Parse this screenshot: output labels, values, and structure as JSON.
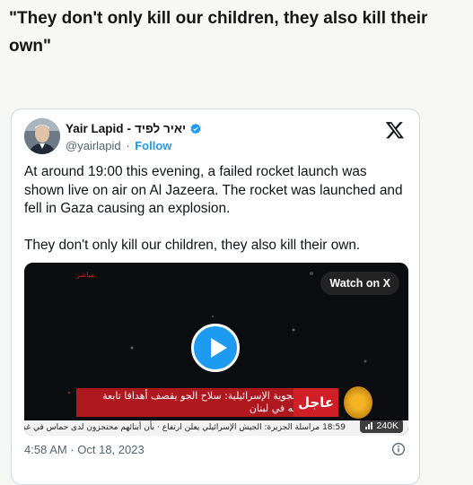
{
  "headline": "\"They don't only kill our children, they also kill their own\"",
  "tweet": {
    "author_name": "Yair Lapid",
    "author_name_hebrew": "יאיר לפיד",
    "name_separator": "-",
    "handle": "@yairlapid",
    "separator_dot": "·",
    "follow_label": "Follow",
    "text_paragraphs": [
      "At around 19:00 this evening, a failed rocket launch was shown live on air on Al Jazeera. The rocket was launched and fell in Gaza causing an explosion.",
      "They don't only kill our children, they also kill their own."
    ],
    "timestamp": "4:58 AM · Oct 18, 2023",
    "media": {
      "watch_label": "Watch on X",
      "views": "240K",
      "banner_urgent": "عاجل",
      "banner_text": "القوات الجوية الإسرائيلية: سلاح الجو يقصف أهدافا تابعة لحزب الله في لبنان",
      "ticker_text": "مراسلة الجزيرة: الجيش الإسرائيلي يعلن ارتفاع · بأن أبنائهم محتجزون لدى حماس في غزة",
      "ticker_time": "18:59",
      "live_tag": "مباشر"
    }
  },
  "colors": {
    "accent": "#1d9bf0",
    "banner_red": "#b01820"
  },
  "icons": [
    "verified-badge-icon",
    "x-logo-icon",
    "play-icon",
    "info-icon",
    "views-icon"
  ]
}
